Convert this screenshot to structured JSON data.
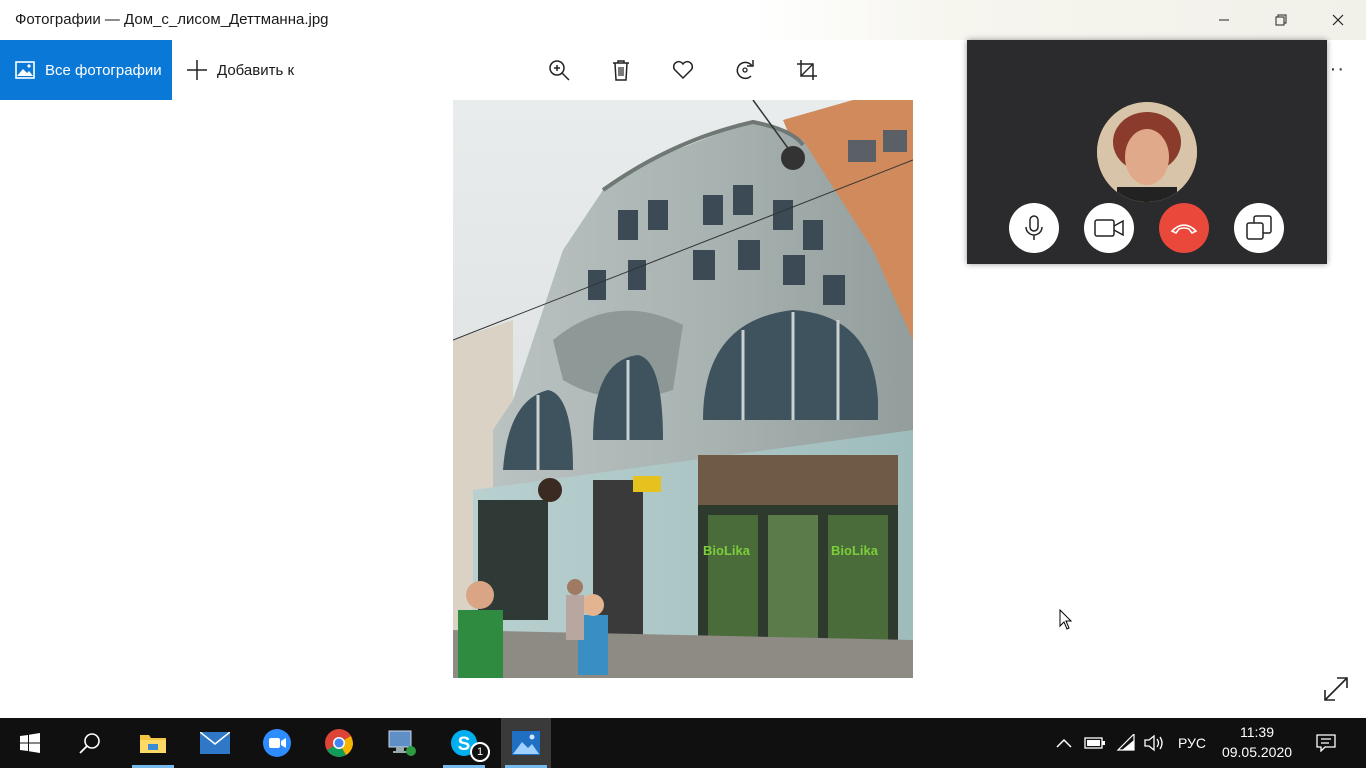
{
  "window": {
    "title": "Фотографии — Дом_с_лисом_Деттманна.jpg"
  },
  "toolbar": {
    "all_photos_label": "Все фотографии",
    "add_to_label": "Добавить к",
    "more_label": "···",
    "icons": [
      "zoom-in-icon",
      "delete-icon",
      "favorite-icon",
      "rotate-icon",
      "crop-icon"
    ]
  },
  "call": {
    "buttons": [
      "microphone",
      "video",
      "end-call",
      "switch-window"
    ],
    "end_color": "#e9483a"
  },
  "taskbar": {
    "apps": [
      "start",
      "search",
      "file-explorer",
      "mail",
      "zoom",
      "chrome",
      "remote-desktop",
      "skype",
      "photos"
    ],
    "skype_badge": "1",
    "language": "РУС",
    "time": "11:39",
    "date": "09.05.2020"
  },
  "colors": {
    "accent": "#0a78d7",
    "taskbar": "#101010",
    "call_bg": "#2b2b2e"
  }
}
